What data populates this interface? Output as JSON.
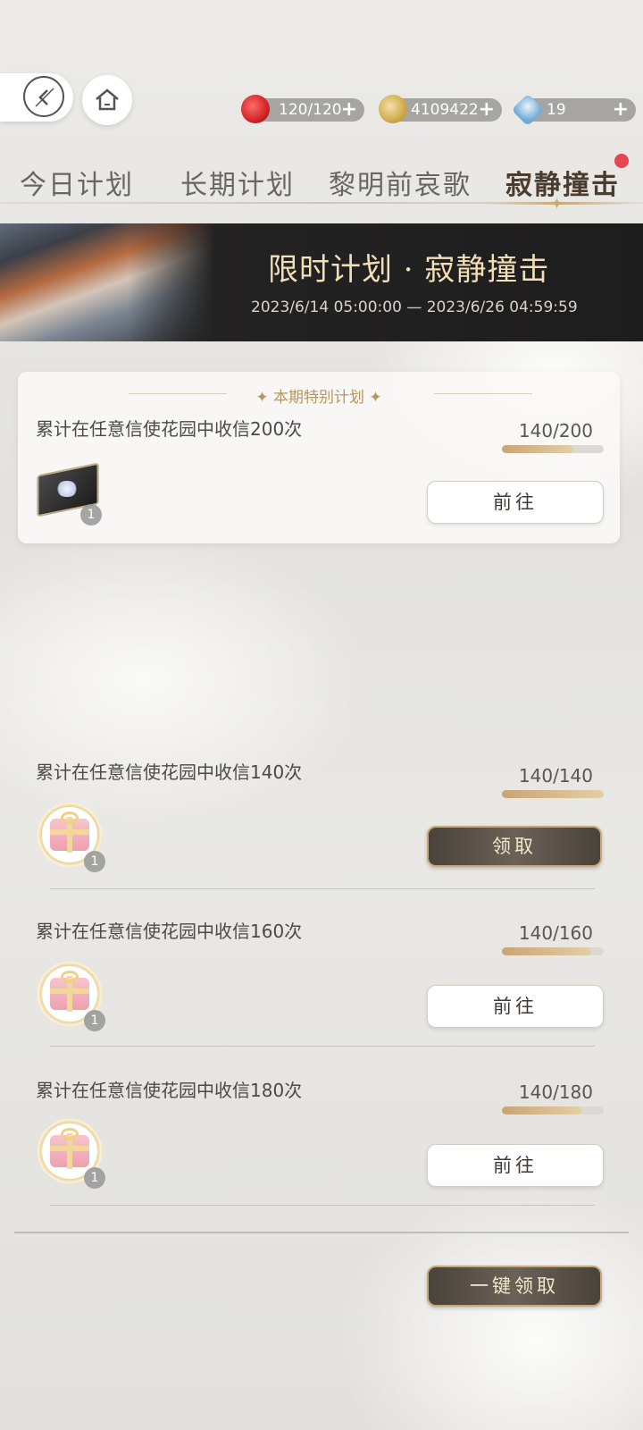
{
  "resources": {
    "energy": "120/120",
    "coins": "4109422",
    "diamonds": "19",
    "plus": "+"
  },
  "tabs": [
    {
      "label": "今日计划"
    },
    {
      "label": "长期计划"
    },
    {
      "label": "黎明前哀歌"
    },
    {
      "label": "寂静撞击"
    }
  ],
  "banner": {
    "title": "限时计划 · 寂静撞击",
    "date_range": "2023/6/14 05:00:00 — 2023/6/26 04:59:59"
  },
  "special": {
    "header": "✦  本期特别计划  ✦",
    "task": "累计在任意信使花园中收信200次",
    "progress": "140/200",
    "progress_value": 0.7,
    "button": "前往",
    "reward_count": "1"
  },
  "tasks": [
    {
      "task": "累计在任意信使花园中收信140次",
      "progress": "140/140",
      "progress_value": 1.0,
      "button": "领取",
      "reward_count": "1"
    },
    {
      "task": "累计在任意信使花园中收信160次",
      "progress": "140/160",
      "progress_value": 0.875,
      "button": "前往",
      "reward_count": "1"
    },
    {
      "task": "累计在任意信使花园中收信180次",
      "progress": "140/180",
      "progress_value": 0.778,
      "button": "前往",
      "reward_count": "1"
    }
  ],
  "claim_all": "一键领取",
  "colors": {
    "accent_gold": "#c9a876",
    "badge_red": "#e64551",
    "banner_bg": "#232222"
  }
}
